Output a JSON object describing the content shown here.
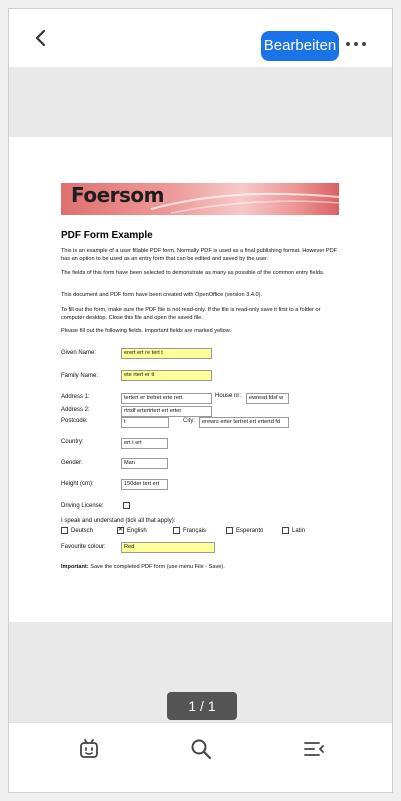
{
  "topbar": {
    "edit_label": "Bearbeiten"
  },
  "pager": {
    "label": "1 / 1"
  },
  "document": {
    "logo_text": "Foersom",
    "title": "PDF Form Example",
    "paragraphs": [
      "This is an example of a user fillable PDF form. Normally PDF is used as a final publishing format. However PDF has an option to be used as an entry form that can be edited and saved by the user.",
      "The fields of this form have been selected to demonstrate as many as possible of the common entry fields.",
      "This document and PDF form have been created with OpenOffice (version 3.4.0).",
      "To fill out the form, make sure the PDF file is not read-only. If the file is read-only save it first to a folder or computer desktop. Close this file and open the saved file.",
      "Please fill out the following fields. Important fields are marked yellow."
    ],
    "form": {
      "given_name_label": "Given Name:",
      "given_name_value": "erert ert re tert t",
      "family_name_label": "Family Name:",
      "family_name_value": "ete rtert er tt",
      "address1_label": "Address 1:",
      "address1_value": "tertert er tretret  erte rert",
      "house_nr_label": "House nr:",
      "house_nr_value": "ewresd fdsf w",
      "address2_label": "Address 2:",
      "address2_value": "rtrtdf ertertrtert ert erter",
      "postcode_label": "Postcode:",
      "postcode_value": "t",
      "city_label": "City:",
      "city_value": "erewrs erter tertret ert ertertd fd",
      "country_label": "Country:",
      "country_value": "ert t ert",
      "gender_label": "Gender:",
      "gender_value": "Man",
      "height_label": "Height (cm):",
      "height_value": "150der tert ert",
      "driving_label": "Driving License:",
      "languages_label": "I speak and understand (tick all that apply):",
      "languages": [
        {
          "name": "Deutsch",
          "checked": false
        },
        {
          "name": "English",
          "checked": true
        },
        {
          "name": "Français",
          "checked": false
        },
        {
          "name": "Esperanto",
          "checked": false
        },
        {
          "name": "Latin",
          "checked": false
        }
      ],
      "colour_label": "Favourite colour:",
      "colour_value": "Red"
    },
    "important_bold": "Important:",
    "important_text": " Save the completed PDF form (use menu File - Save)."
  },
  "bottombar": {
    "icons": [
      "ai-assistant-icon",
      "search-icon",
      "outline-collapse-icon"
    ]
  }
}
